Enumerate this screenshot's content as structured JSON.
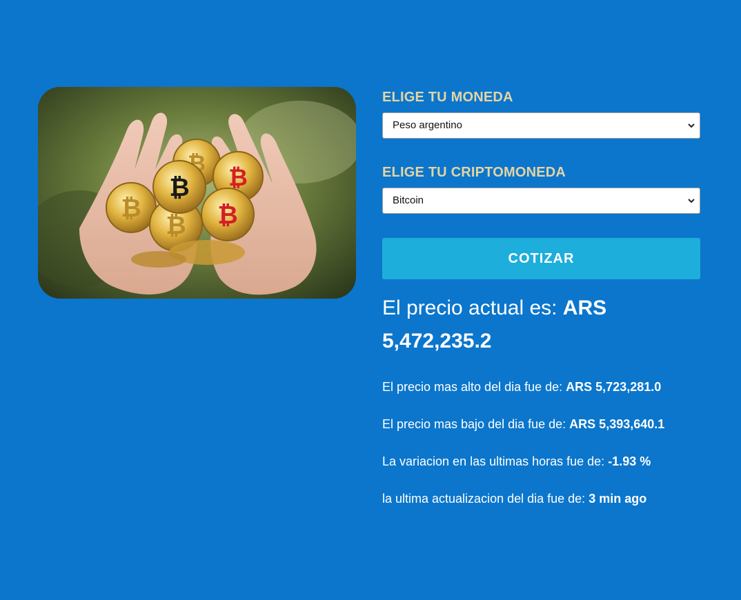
{
  "form": {
    "currency_label": "ELIGE TU MONEDA",
    "currency_selected": "Peso argentino",
    "crypto_label": "ELIGE TU CRIPTOMONEDA",
    "crypto_selected": "Bitcoin",
    "submit_label": "COTIZAR"
  },
  "result": {
    "price_prefix": "El precio actual es: ",
    "price_value": "ARS 5,472,235.2",
    "high_prefix": "El precio mas alto del dia fue de: ",
    "high_value": "ARS 5,723,281.0",
    "low_prefix": "El precio mas bajo del dia fue de: ",
    "low_value": "ARS 5,393,640.1",
    "change_prefix": "La variacion en las ultimas horas fue de: ",
    "change_value": "-1.93 %",
    "updated_prefix": "la ultima actualizacion del dia fue de: ",
    "updated_value": "3 min ago"
  },
  "icons": {
    "select_chevron": "chevron-down-icon",
    "hero": "bitcoin-coins-in-hands-image"
  },
  "colors": {
    "background": "#0b76cc",
    "label": "#e5d4a3",
    "button": "#1eaedb",
    "text": "#ffffff"
  }
}
